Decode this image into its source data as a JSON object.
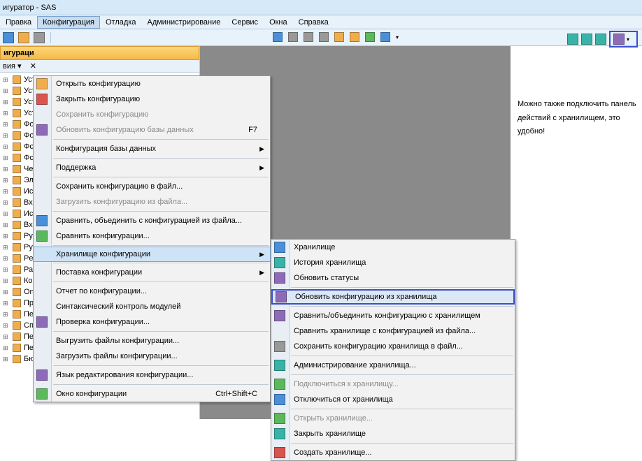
{
  "title": "игуратор - SAS",
  "menubar": [
    "Правка",
    "Конфигурация",
    "Отладка",
    "Администрирование",
    "Сервис",
    "Окна",
    "Справка"
  ],
  "menubar_active": 1,
  "pane_header": "игураци",
  "note_text": "Можно также подключить панель действий с хранилищем, это удобно!",
  "tree": [
    {
      "label": "Уст",
      "lock": false
    },
    {
      "label": "Уст",
      "lock": false
    },
    {
      "label": "Уст",
      "lock": false
    },
    {
      "label": "Уст",
      "lock": false
    },
    {
      "label": "Фо",
      "lock": false
    },
    {
      "label": "Фо",
      "lock": false
    },
    {
      "label": "Фо",
      "lock": false
    },
    {
      "label": "Фо",
      "lock": false
    },
    {
      "label": "Чек",
      "lock": false
    },
    {
      "label": "Эле",
      "lock": false
    },
    {
      "label": "Исх",
      "lock": false
    },
    {
      "label": "Вхо",
      "lock": false
    },
    {
      "label": "Исх",
      "lock": false
    },
    {
      "label": "Вхо",
      "lock": false
    },
    {
      "label": "Руч",
      "lock": false
    },
    {
      "label": "Руч",
      "lock": false
    },
    {
      "label": "Per",
      "lock": false
    },
    {
      "label": "Рас",
      "lock": false
    },
    {
      "label": "Кор",
      "lock": false
    },
    {
      "label": "One",
      "lock": false
    },
    {
      "label": "ПринятиеКУчетуОС",
      "lock": true
    },
    {
      "label": "ПеремещениеОС",
      "lock": true
    },
    {
      "label": "СписаниеОС",
      "lock": true
    },
    {
      "label": "ПередачаОС",
      "lock": true
    },
    {
      "label": "ПереоценкаОС",
      "lock": true
    },
    {
      "label": "БюджетДоходовИРасходов",
      "lock": true
    }
  ],
  "menu1": [
    {
      "label": "Открыть конфигурацию",
      "icon": "open-icon"
    },
    {
      "label": "Закрыть конфигурацию",
      "icon": "close-icon"
    },
    {
      "label": "Сохранить конфигурацию",
      "disabled": true
    },
    {
      "label": "Обновить конфигурацию базы данных",
      "icon": "db-icon",
      "disabled": true,
      "shortcut": "F7"
    },
    {
      "sep": true
    },
    {
      "label": "Конфигурация базы данных",
      "arrow": true
    },
    {
      "sep": true
    },
    {
      "label": "Поддержка",
      "arrow": true
    },
    {
      "sep": true
    },
    {
      "label": "Сохранить конфигурацию в файл..."
    },
    {
      "label": "Загрузить конфигурацию из файла...",
      "disabled": true
    },
    {
      "sep": true
    },
    {
      "label": "Сравнить, объединить с конфигурацией из файла...",
      "icon": "compare-icon"
    },
    {
      "label": "Сравнить конфигурации...",
      "icon": "compare2-icon"
    },
    {
      "sep": true
    },
    {
      "label": "Хранилище конфигурации",
      "arrow": true,
      "hover": true
    },
    {
      "sep": true
    },
    {
      "label": "Поставка конфигурации",
      "arrow": true
    },
    {
      "sep": true
    },
    {
      "label": "Отчет по конфигурации..."
    },
    {
      "label": "Синтаксический контроль модулей"
    },
    {
      "label": "Проверка конфигурации...",
      "icon": "check-icon"
    },
    {
      "sep": true
    },
    {
      "label": "Выгрузить файлы конфигурации..."
    },
    {
      "label": "Загрузить файлы конфигурации..."
    },
    {
      "sep": true
    },
    {
      "label": "Язык редактирования конфигурации...",
      "icon": "lang-icon"
    },
    {
      "sep": true
    },
    {
      "label": "Окно конфигурации",
      "icon": "window-icon",
      "shortcut": "Ctrl+Shift+C"
    }
  ],
  "menu2": [
    {
      "label": "Хранилище",
      "icon": "repo-icon"
    },
    {
      "label": "История хранилища",
      "icon": "history-icon"
    },
    {
      "label": "Обновить статусы",
      "icon": "refresh-icon"
    },
    {
      "sep": true
    },
    {
      "label": "Обновить конфигурацию из хранилища",
      "icon": "update-icon",
      "hover": true,
      "boxed": true
    },
    {
      "sep": true
    },
    {
      "label": "Сравнить/объединить конфигурацию с хранилищем",
      "icon": "merge-icon"
    },
    {
      "label": "Сравнить хранилище с конфигурацией из файла..."
    },
    {
      "label": "Сохранить конфигурацию хранилища в файл...",
      "icon": "save-icon"
    },
    {
      "sep": true
    },
    {
      "label": "Администрирование хранилища...",
      "icon": "admin-icon"
    },
    {
      "sep": true
    },
    {
      "label": "Подключиться к хранилищу...",
      "icon": "connect-icon",
      "disabled": true
    },
    {
      "label": "Отключиться от хранилища",
      "icon": "disconnect-icon"
    },
    {
      "sep": true
    },
    {
      "label": "Открыть хранилище...",
      "icon": "open-repo-icon",
      "disabled": true
    },
    {
      "label": "Закрыть хранилище",
      "icon": "close-repo-icon"
    },
    {
      "sep": true
    },
    {
      "label": "Создать хранилище...",
      "icon": "create-icon"
    }
  ]
}
